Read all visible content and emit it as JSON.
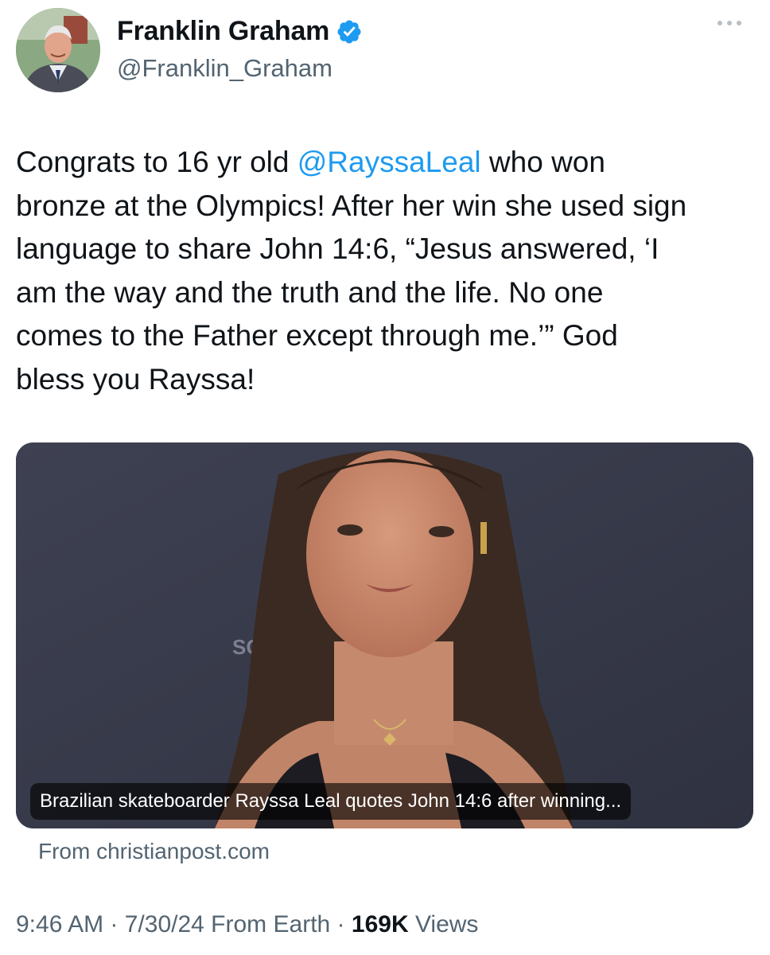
{
  "author": {
    "display_name": "Franklin Graham",
    "handle": "@Franklin_Graham",
    "verified_icon": "verified-badge-icon",
    "avatar_icon": "avatar-photo"
  },
  "tweet": {
    "text_before": "Congrats to 16 yr old ",
    "mention": "@RayssaLeal",
    "text_after": " who won\nbronze at the Olympics! After her win she used sign\nlanguage to share John 14:6, “Jesus answered, ‘I\nam the way and the truth and the life. No one\ncomes to the Father except through me.’” God\nbless you Rayssa!"
  },
  "card": {
    "caption": "Brazilian skateboarder Rayssa Leal quotes John 14:6 after winning...",
    "source": "From christianpost.com",
    "image_icon": "article-photo"
  },
  "meta": {
    "time": "9:46 AM",
    "sep1": " · ",
    "date": "7/30/24",
    "client": " From Earth",
    "sep2": " · ",
    "views_count": "169K",
    "views_label": " Views"
  },
  "colors": {
    "link": "#1d9bf0",
    "text": "#0f1419",
    "secondary": "#536471"
  }
}
